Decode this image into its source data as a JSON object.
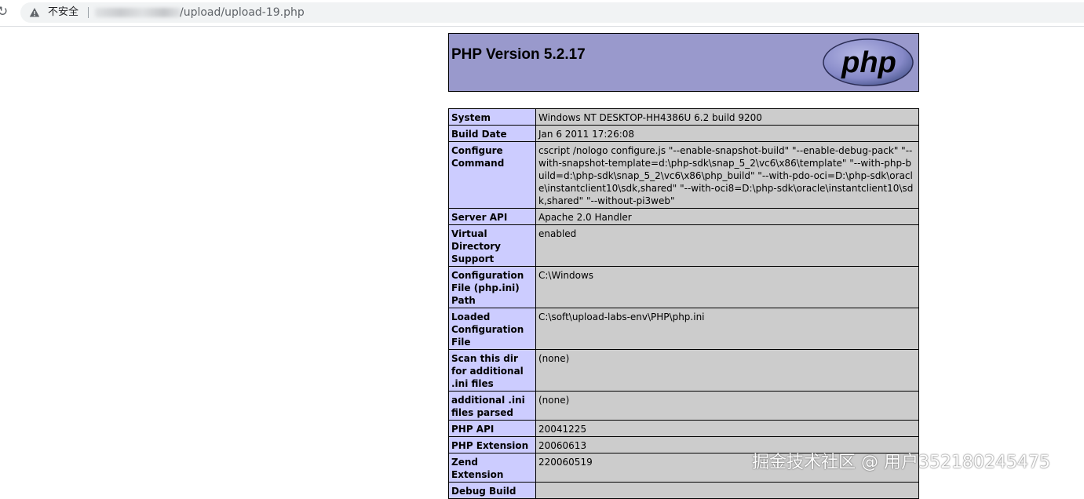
{
  "browser": {
    "security_label": "不安全",
    "url_path": "/upload/upload-19.php"
  },
  "php": {
    "title": "PHP Version 5.2.17",
    "logo_text": "php",
    "rows": [
      {
        "key": "System",
        "value": "Windows NT DESKTOP-HH4386U 6.2 build 9200"
      },
      {
        "key": "Build Date",
        "value": "Jan 6 2011 17:26:08"
      },
      {
        "key": "Configure Command",
        "value": "cscript /nologo configure.js \"--enable-snapshot-build\" \"--enable-debug-pack\" \"--with-snapshot-template=d:\\php-sdk\\snap_5_2\\vc6\\x86\\template\" \"--with-php-build=d:\\php-sdk\\snap_5_2\\vc6\\x86\\php_build\" \"--with-pdo-oci=D:\\php-sdk\\oracle\\instantclient10\\sdk,shared\" \"--with-oci8=D:\\php-sdk\\oracle\\instantclient10\\sdk,shared\" \"--without-pi3web\""
      },
      {
        "key": "Server API",
        "value": "Apache 2.0 Handler"
      },
      {
        "key": "Virtual Directory Support",
        "value": "enabled"
      },
      {
        "key": "Configuration File (php.ini) Path",
        "value": "C:\\Windows"
      },
      {
        "key": "Loaded Configuration File",
        "value": "C:\\soft\\upload-labs-env\\PHP\\php.ini"
      },
      {
        "key": "Scan this dir for additional .ini files",
        "value": "(none)"
      },
      {
        "key": "additional .ini files parsed",
        "value": "(none)"
      },
      {
        "key": "PHP API",
        "value": "20041225"
      },
      {
        "key": "PHP Extension",
        "value": "20060613"
      },
      {
        "key": "Zend Extension",
        "value": "220060519"
      },
      {
        "key": "Debug Build",
        "value": ""
      }
    ]
  },
  "watermark": "掘金技术社区 @ 用户352180245475",
  "colors": {
    "header_bg": "#9999cc",
    "key_bg": "#ccccff",
    "value_bg": "#cccccc"
  }
}
